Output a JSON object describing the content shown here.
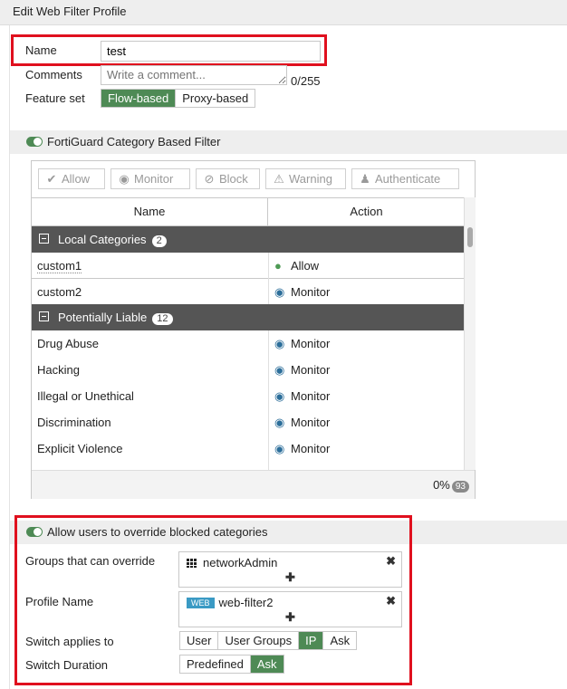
{
  "title": "Edit Web Filter Profile",
  "form": {
    "name_label": "Name",
    "name_value": "test",
    "comments_label": "Comments",
    "comments_placeholder": "Write a comment...",
    "comments_count": "0/255",
    "feature_label": "Feature set",
    "feature_options": [
      "Flow-based",
      "Proxy-based"
    ],
    "feature_selected": "Flow-based"
  },
  "fortiguard": {
    "label": "FortiGuard Category Based Filter",
    "toolbar": {
      "allow": "Allow",
      "monitor": "Monitor",
      "block": "Block",
      "warning": "Warning",
      "authenticate": "Authenticate"
    },
    "columns": {
      "name": "Name",
      "action": "Action"
    },
    "groups": [
      {
        "label": "Local Categories",
        "count": "2"
      },
      {
        "label": "Potentially Liable",
        "count": "12"
      }
    ],
    "rows": [
      {
        "name": "custom1",
        "action": "Allow",
        "icon": "check-circle-icon"
      },
      {
        "name": "custom2",
        "action": "Monitor",
        "icon": "eye-icon"
      },
      {
        "name": "Drug Abuse",
        "action": "Monitor",
        "icon": "eye-icon"
      },
      {
        "name": "Hacking",
        "action": "Monitor",
        "icon": "eye-icon"
      },
      {
        "name": "Illegal or Unethical",
        "action": "Monitor",
        "icon": "eye-icon"
      },
      {
        "name": "Discrimination",
        "action": "Monitor",
        "icon": "eye-icon"
      },
      {
        "name": "Explicit Violence",
        "action": "Monitor",
        "icon": "eye-icon"
      }
    ],
    "footer_pct": "0%",
    "footer_total": "93"
  },
  "override": {
    "label": "Allow users to override blocked categories",
    "groups_label": "Groups that can override",
    "groups_value": "networkAdmin",
    "profile_label": "Profile Name",
    "profile_tag": "WEB",
    "profile_value": "web-filter2",
    "switch_applies_label": "Switch applies to",
    "switch_applies_options": [
      "User",
      "User Groups",
      "IP",
      "Ask"
    ],
    "switch_applies_selected": "IP",
    "switch_duration_label": "Switch Duration",
    "switch_duration_options": [
      "Predefined",
      "Ask"
    ],
    "switch_duration_selected": "Ask"
  },
  "colors": {
    "accent_green": "#4e8a55",
    "highlight_red": "#e0101e",
    "group_header": "#555555",
    "allow_icon": "#4e9a55",
    "monitor_icon": "#2c6e9a"
  }
}
